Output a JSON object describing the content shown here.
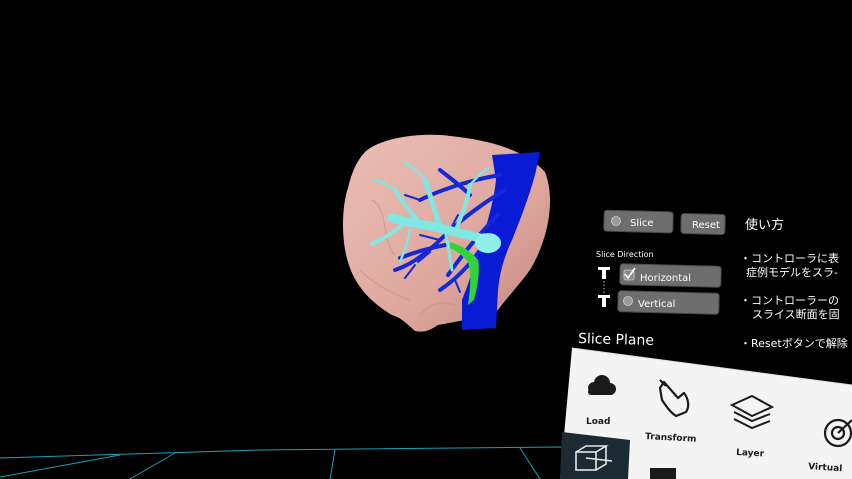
{
  "slice_panel": {
    "slice_label": "Slice",
    "reset_label": "Reset",
    "direction_title": "Slice Direction",
    "horizontal_label": "Horizontal",
    "vertical_label": "Vertical",
    "horizontal_checked": true,
    "vertical_checked": false
  },
  "help_panel": {
    "title": "使い方",
    "line1": "・コントローラに表",
    "line2": "症例モデルをスラ-",
    "line3": "・コントローラーの",
    "line4": "スライス断面を固",
    "line5": "・Resetボタンで解除"
  },
  "tool_menu": {
    "title": "Slice Plane",
    "items": [
      {
        "label": "Load",
        "icon": "cloud-icon"
      },
      {
        "label": "Transform",
        "icon": "hand-icon"
      },
      {
        "label": "Layer",
        "icon": "layers-icon"
      },
      {
        "label": "Virtual",
        "icon": "target-icon"
      }
    ],
    "bottom_icon": "slice-plane-icon"
  },
  "colors": {
    "liver": "#f2b7ad",
    "portal_vein": "#7fe8e2",
    "hepatic_vein": "#1428d8",
    "ivc": "#0a1bd6",
    "artery": "#2fd43a",
    "grid": "#1a9fb8",
    "button": "#6e6e6e",
    "menu_bg": "#f4f4f4"
  }
}
